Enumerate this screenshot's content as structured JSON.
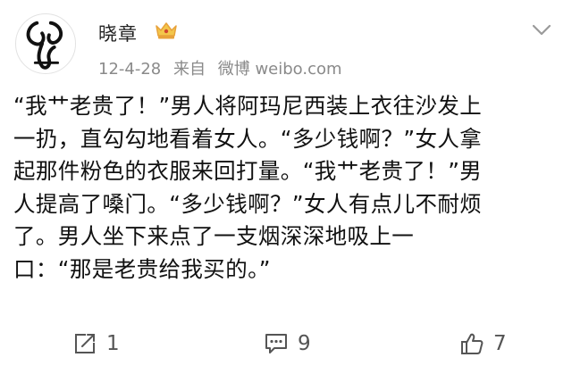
{
  "user": {
    "name": "晓章",
    "date": "12-4-28",
    "source_prefix": "来自",
    "source": "微博 weibo.com"
  },
  "post": {
    "lines": [
      "“我艹老贵了！”男人将阿玛尼西装上衣往沙发上",
      "一扔，直勾勾地看着女人。“多少钱啊？”女人拿",
      "起那件粉色的衣服来回打量。“我艹老贵了！”男",
      "人提高了嗓门。“多少钱啊？”女人有点儿不耐烦",
      "了。男人坐下来点了一支烟深深地吸上一",
      "口：“那是老贵给我买的。”"
    ]
  },
  "actions": {
    "repost_count": "1",
    "comment_count": "9",
    "like_count": "7"
  },
  "icons": {
    "verified_badge": "crown-icon",
    "menu": "chevron-down-icon",
    "repost": "repost-icon",
    "comment": "comment-icon",
    "like": "thumbs-up-icon"
  },
  "colors": {
    "badge_gold": "#e8a23a",
    "meta_gray": "#8a8a8a",
    "text": "#111111"
  }
}
